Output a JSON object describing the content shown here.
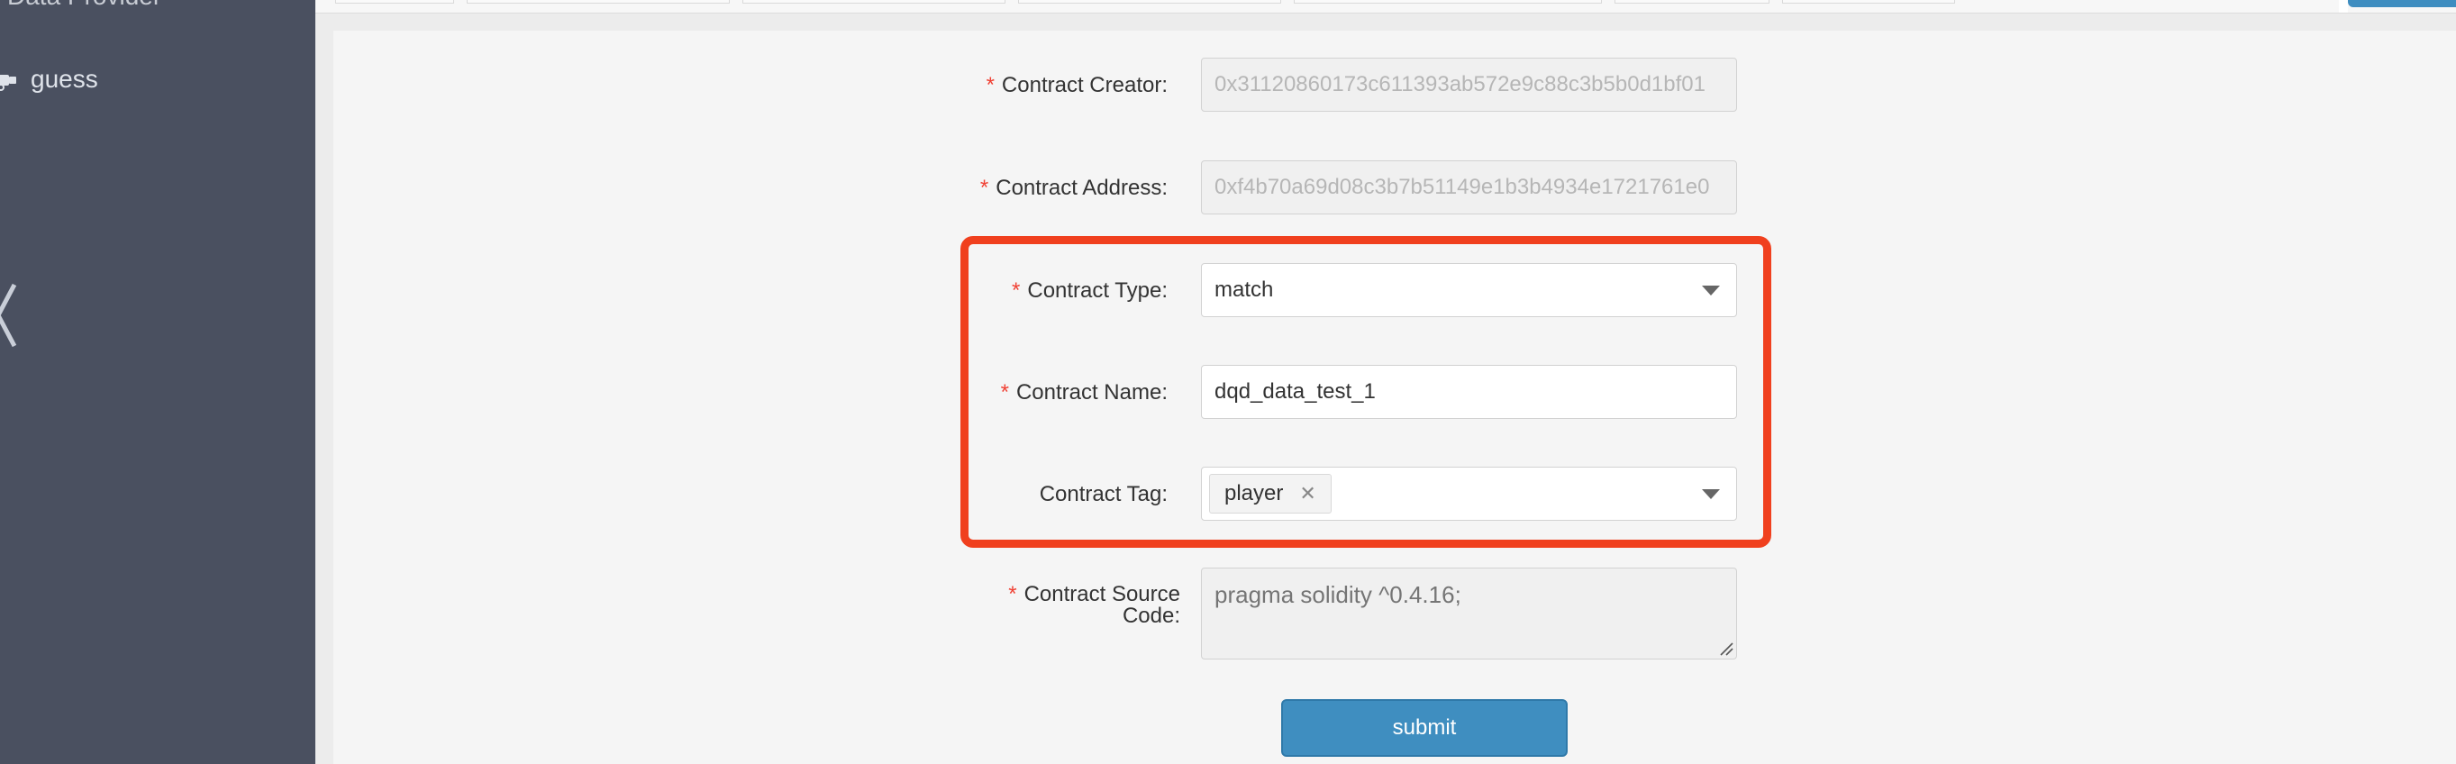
{
  "sidebar": {
    "top_item_label": "Data Provider",
    "items": [
      {
        "icon": "guess-icon",
        "label": "guess"
      }
    ],
    "collapse_icon": "chevron-left-icon",
    "background": "#4a5060"
  },
  "form": {
    "contract_creator": {
      "label": "Contract Creator:",
      "value": "0x31120860173c611393ab572e9c88c3b5b0d1bf01",
      "required": true,
      "disabled": true
    },
    "contract_address": {
      "label": "Contract Address:",
      "value": "0xf4b70a69d08c3b7b51149e1b3b4934e1721761e0",
      "required": true,
      "disabled": true
    },
    "contract_type": {
      "label": "Contract Type:",
      "value": "match",
      "required": true
    },
    "contract_name": {
      "label": "Contract Name:",
      "value": "dqd_data_test_1",
      "required": true
    },
    "contract_tag": {
      "label": "Contract Tag:",
      "tags": [
        "player"
      ],
      "required": false
    },
    "contract_source_code": {
      "label_line1": "Contract Source",
      "label_line2": "Code:",
      "placeholder": "pragma solidity ^0.4.16;",
      "required": true,
      "disabled": true
    },
    "required_marker": "*",
    "submit_label": "submit"
  },
  "colors": {
    "accent": "#3f8ec0",
    "required": "#f04134",
    "highlight": "#f0401e"
  }
}
